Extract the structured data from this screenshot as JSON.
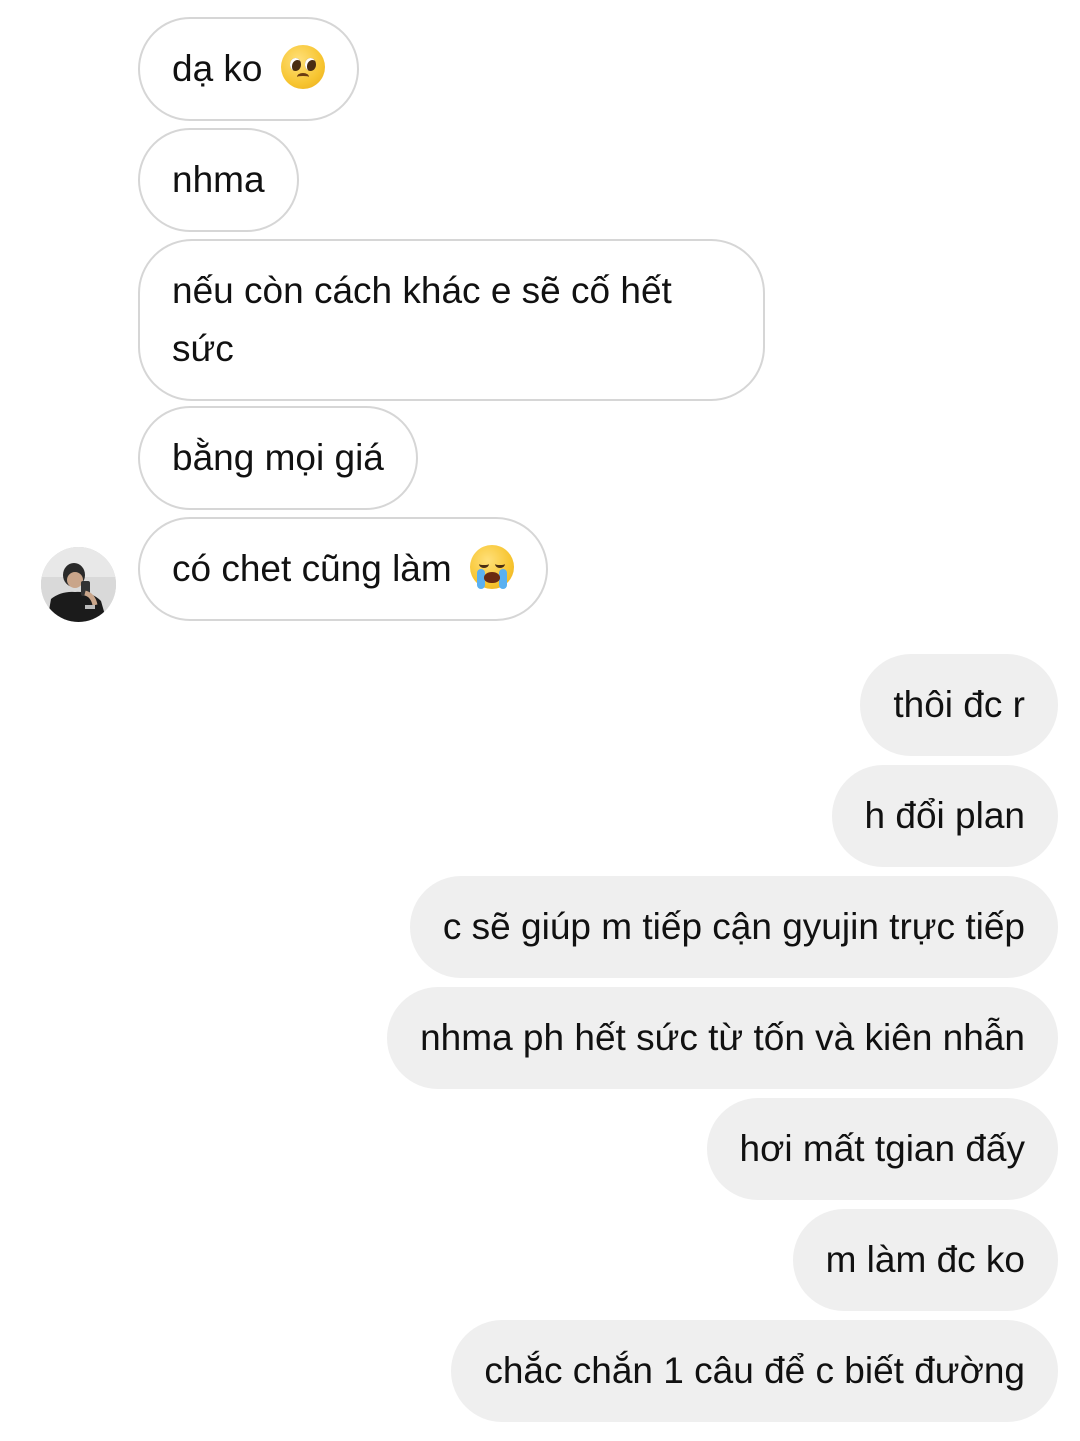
{
  "conversation": {
    "incoming": [
      {
        "text": "dạ ko",
        "emoji": "pleading-face-emoji"
      },
      {
        "text": "nhma"
      },
      {
        "text": "nếu còn cách khác e sẽ cố hết sức"
      },
      {
        "text": "bằng mọi giá"
      },
      {
        "text": "có chet cũng làm",
        "emoji": "loudly-crying-face-emoji"
      }
    ],
    "outgoing": [
      {
        "text": "thôi đc r"
      },
      {
        "text": "h đổi plan"
      },
      {
        "text": "c sẽ giúp m tiếp cận gyujin trực tiếp"
      },
      {
        "text": "nhma ph hết sức từ tốn và kiên nhẫn"
      },
      {
        "text": "hơi mất tgian đấy"
      },
      {
        "text": "m làm đc ko"
      },
      {
        "text": "chắc chắn 1 câu để c biết đường"
      }
    ]
  },
  "colors": {
    "incoming_bubble_bg": "#ffffff",
    "incoming_bubble_border": "#d6d6d6",
    "outgoing_bubble_bg": "#efefef",
    "text": "#111111"
  }
}
